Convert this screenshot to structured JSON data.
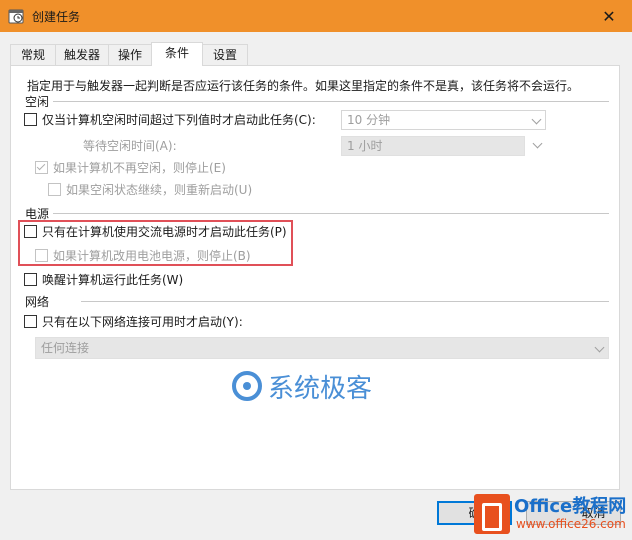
{
  "window": {
    "title": "创建任务"
  },
  "tabs": [
    {
      "label": "常规",
      "active": false
    },
    {
      "label": "触发器",
      "active": false
    },
    {
      "label": "操作",
      "active": false
    },
    {
      "label": "条件",
      "active": true
    },
    {
      "label": "设置",
      "active": false
    }
  ],
  "description": "指定用于与触发器一起判断是否应运行该任务的条件。如果这里指定的条件不是真，该任务将不会运行。",
  "idle": {
    "group_label": "空闲",
    "start_only_if_idle": {
      "label": "仅当计算机空闲时间超过下列值时才启动此任务(C):",
      "checked": false,
      "value": "10 分钟"
    },
    "wait_for_idle": {
      "label": "等待空闲时间(A):",
      "value": "1 小时"
    },
    "stop_if_not_idle": {
      "label": "如果计算机不再空闲，则停止(E)",
      "checked": true
    },
    "restart_if_idle_resumes": {
      "label": "如果空闲状态继续，则重新启动(U)",
      "checked": false
    }
  },
  "power": {
    "group_label": "电源",
    "ac_only": {
      "label": "只有在计算机使用交流电源时才启动此任务(P)",
      "checked": false
    },
    "stop_on_battery": {
      "label": "如果计算机改用电池电源，则停止(B)",
      "checked": false
    },
    "wake_to_run": {
      "label": "唤醒计算机运行此任务(W)",
      "checked": false
    }
  },
  "network": {
    "group_label": "网络",
    "only_if_available": {
      "label": "只有在以下网络连接可用时才启动(Y):",
      "checked": false
    },
    "connection": {
      "value": "任何连接"
    }
  },
  "buttons": {
    "ok_visible": "确",
    "cancel_visible": "取消"
  },
  "watermarks": {
    "center": "系统极客",
    "brand": "Office教程网",
    "site": "www.office26.com"
  },
  "colors": {
    "titlebar": "#f0902a",
    "highlight": "#e05058",
    "accent": "#0078d7"
  }
}
